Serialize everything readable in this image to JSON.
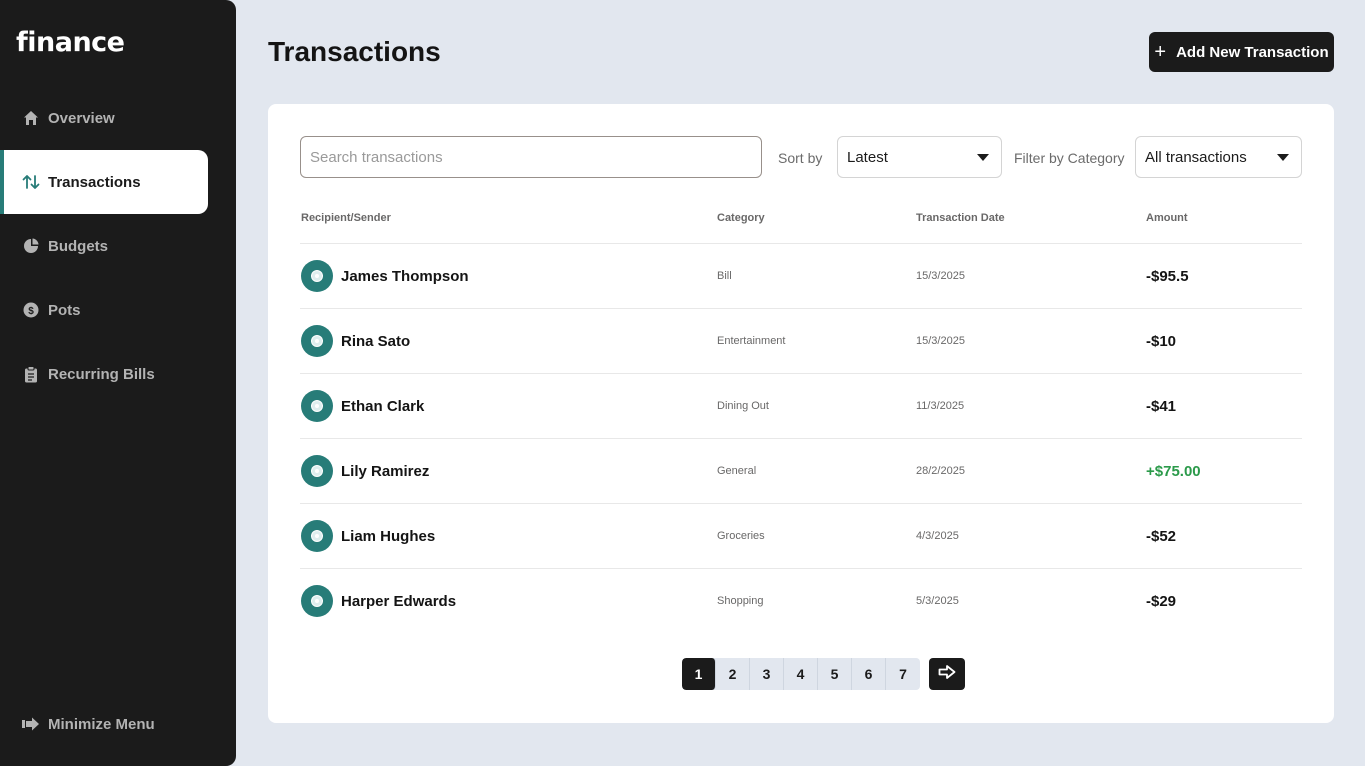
{
  "app": {
    "logo": "finance"
  },
  "sidebar": {
    "items": [
      {
        "label": "Overview",
        "icon": "home-icon"
      },
      {
        "label": "Transactions",
        "icon": "arrows-up-down-icon",
        "active": true
      },
      {
        "label": "Budgets",
        "icon": "pie-chart-icon"
      },
      {
        "label": "Pots",
        "icon": "dollar-coin-icon"
      },
      {
        "label": "Recurring Bills",
        "icon": "clipboard-icon"
      }
    ],
    "minimize_label": "Minimize Menu"
  },
  "header": {
    "title": "Transactions",
    "add_button": "Add New Transaction"
  },
  "filters": {
    "search_placeholder": "Search transactions",
    "sort_label": "Sort by",
    "sort_value": "Latest",
    "category_label": "Filter by Category",
    "category_value": "All transactions"
  },
  "table": {
    "headers": [
      "Recipient/Sender",
      "Category",
      "Transaction Date",
      "Amount"
    ],
    "rows": [
      {
        "name": "James Thompson",
        "category": "Bill",
        "date": "15/3/2025",
        "amount": "-$95.5"
      },
      {
        "name": "Rina Sato",
        "category": "Entertainment",
        "date": "15/3/2025",
        "amount": "-$10"
      },
      {
        "name": "Ethan Clark",
        "category": "Dining Out",
        "date": "11/3/2025",
        "amount": "-$41"
      },
      {
        "name": "Lily Ramirez",
        "category": "General",
        "date": "28/2/2025",
        "amount": "+$75.00"
      },
      {
        "name": "Liam Hughes",
        "category": "Groceries",
        "date": "4/3/2025",
        "amount": "-$52"
      },
      {
        "name": "Harper Edwards",
        "category": "Shopping",
        "date": "5/3/2025",
        "amount": "-$29"
      }
    ]
  },
  "pagination": {
    "pages": [
      "1",
      "2",
      "3",
      "4",
      "5",
      "6",
      "7"
    ],
    "current": "1"
  },
  "colors": {
    "accent": "#277c78",
    "positive": "#2b9a4a",
    "dark": "#1b1b1b",
    "background": "#e2e7ef"
  }
}
